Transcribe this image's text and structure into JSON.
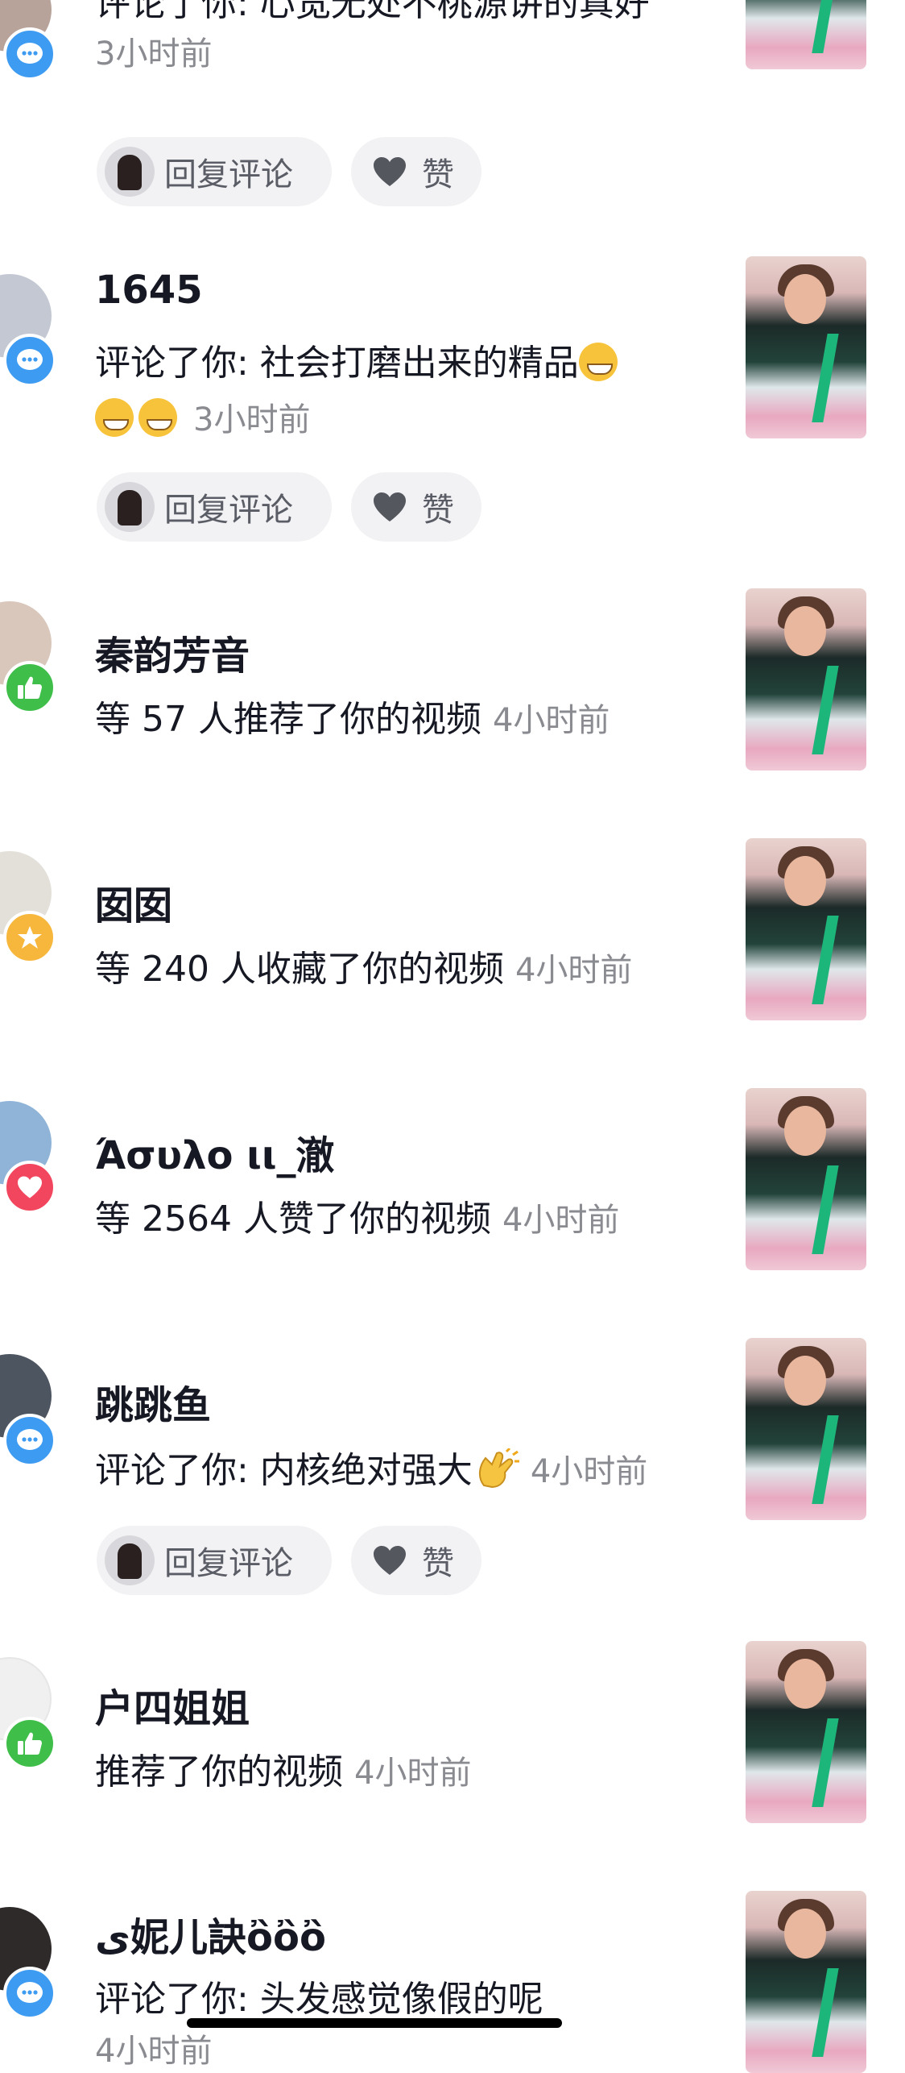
{
  "actions": {
    "reply_label": "回复评论",
    "like_label": "赞"
  },
  "notifications": [
    {
      "name": "",
      "text": "评论了你: 心宽无处不桃源讲的真好",
      "time": "3小时前",
      "badge": "comment-icon"
    },
    {
      "name": "1645",
      "text": "评论了你: 社会打磨出来的精品",
      "time": "3小时前",
      "badge": "comment-icon"
    },
    {
      "name": "秦韵芳音",
      "text": "等 57 人推荐了你的视频",
      "time": "4小时前",
      "badge": "thumbs-up-icon"
    },
    {
      "name": "囡囡",
      "text": "等 240 人收藏了你的视频",
      "time": "4小时前",
      "badge": "star-icon"
    },
    {
      "name": "Άσυλο ιι_澈",
      "text": "等 2564 人赞了你的视频",
      "time": "4小时前",
      "badge": "heart-icon"
    },
    {
      "name": "跳跳鱼",
      "text": "评论了你: 内核绝对强大",
      "time": "4小时前",
      "badge": "comment-icon"
    },
    {
      "name": "户四姐姐",
      "text": "推荐了你的视频",
      "time": "4小时前",
      "badge": "thumbs-up-icon"
    },
    {
      "name": "ى妮儿訣ὂὂὂ",
      "text": "评论了你: 头发感觉像假的呢",
      "time": "4小时前",
      "badge": "comment-icon"
    }
  ],
  "colors": {
    "comment": "#3d9bf2",
    "like": "#3fbf4a",
    "favorite": "#f6b73c",
    "heart": "#f2465e",
    "secondary_text": "#8a8b91"
  }
}
